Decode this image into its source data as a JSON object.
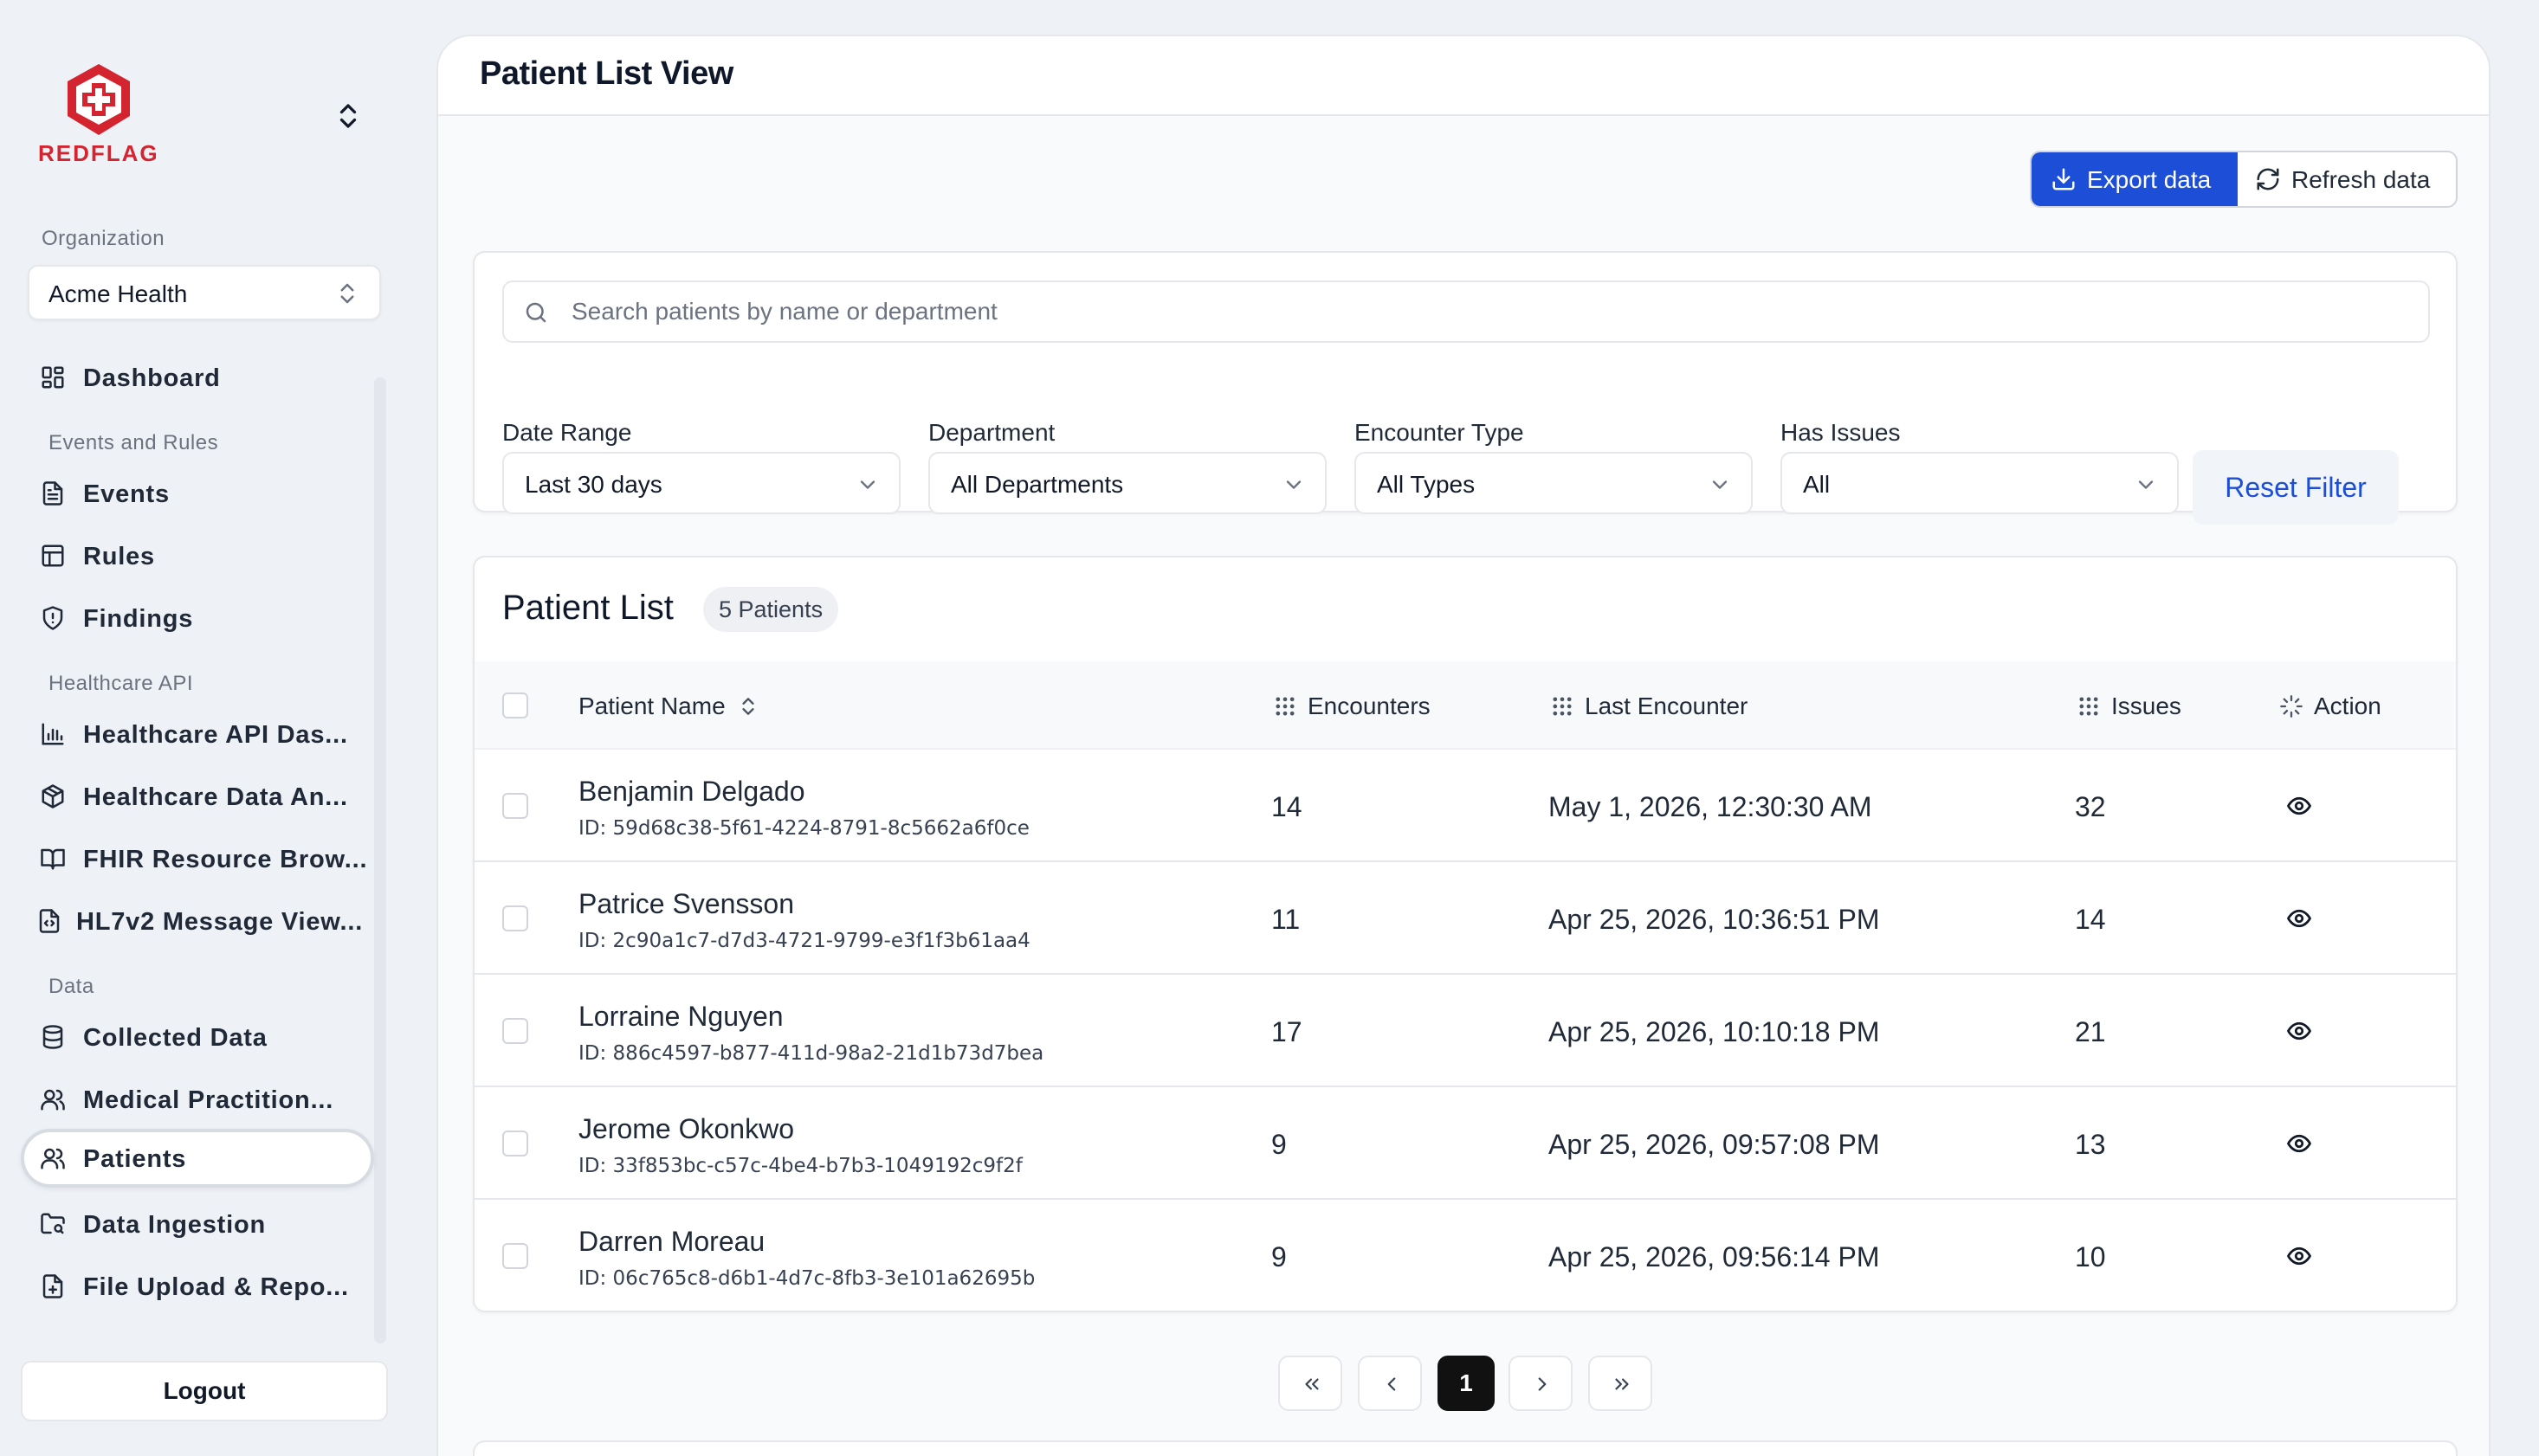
{
  "brand": {
    "name": "REDFLAG",
    "color": "#d3242f"
  },
  "organization": {
    "label": "Organization",
    "value": "Acme Health"
  },
  "nav": {
    "dashboard": {
      "label": "Dashboard",
      "icon": "dashboard-grid-icon"
    },
    "sections": {
      "events_rules": "Events and Rules",
      "healthcare_api": "Healthcare API",
      "data": "Data"
    },
    "items": [
      {
        "label": "Events",
        "icon": "file-text-icon"
      },
      {
        "label": "Rules",
        "icon": "table-icon"
      },
      {
        "label": "Findings",
        "icon": "shield-alert-icon"
      },
      {
        "label": "Healthcare API Das...",
        "icon": "bar-chart-icon"
      },
      {
        "label": "Healthcare Data An...",
        "icon": "package-icon"
      },
      {
        "label": "FHIR Resource Brow...",
        "icon": "book-open-icon"
      },
      {
        "label": "HL7v2 Message View...",
        "icon": "file-code-icon"
      },
      {
        "label": "Collected Data",
        "icon": "database-icon"
      },
      {
        "label": "Medical Practition...",
        "icon": "users-icon"
      },
      {
        "label": "Patients",
        "icon": "users-icon"
      },
      {
        "label": "Data Ingestion",
        "icon": "folder-search-icon"
      },
      {
        "label": "File Upload & Repo...",
        "icon": "file-plus-icon"
      }
    ],
    "active": "Patients",
    "logout": "Logout"
  },
  "page": {
    "title": "Patient List View"
  },
  "toolbar": {
    "export_label": "Export data",
    "refresh_label": "Refresh data",
    "accent": "#1d4ed8"
  },
  "filters": {
    "search_placeholder": "Search patients by name or department",
    "date_range": {
      "label": "Date Range",
      "value": "Last 30 days"
    },
    "department": {
      "label": "Department",
      "value": "All Departments"
    },
    "encounter_type": {
      "label": "Encounter Type",
      "value": "All Types"
    },
    "has_issues": {
      "label": "Has Issues",
      "value": "All"
    },
    "reset_label": "Reset Filter"
  },
  "patient_list": {
    "title": "Patient List",
    "count_badge": "5 Patients",
    "columns": {
      "name": "Patient Name",
      "encounters": "Encounters",
      "last_encounter": "Last Encounter",
      "issues": "Issues",
      "action": "Action"
    },
    "rows": [
      {
        "name": "Benjamin Delgado",
        "id": "ID: 59d68c38-5f61-4224-8791-8c5662a6f0ce",
        "encounters": "14",
        "last_encounter": "May 1, 2026, 12:30:30 AM",
        "issues": "32"
      },
      {
        "name": "Patrice Svensson",
        "id": "ID: 2c90a1c7-d7d3-4721-9799-e3f1f3b61aa4",
        "encounters": "11",
        "last_encounter": "Apr 25, 2026, 10:36:51 PM",
        "issues": "14"
      },
      {
        "name": "Lorraine Nguyen",
        "id": "ID: 886c4597-b877-411d-98a2-21d1b73d7bea",
        "encounters": "17",
        "last_encounter": "Apr 25, 2026, 10:10:18 PM",
        "issues": "21"
      },
      {
        "name": "Jerome Okonkwo",
        "id": "ID: 33f853bc-c57c-4be4-b7b3-1049192c9f2f",
        "encounters": "9",
        "last_encounter": "Apr 25, 2026, 09:57:08 PM",
        "issues": "13"
      },
      {
        "name": "Darren Moreau",
        "id": "ID: 06c765c8-d6b1-4d7c-8fb3-3e101a62695b",
        "encounters": "9",
        "last_encounter": "Apr 25, 2026, 09:56:14 PM",
        "issues": "10"
      }
    ]
  },
  "pagination": {
    "current_page": "1"
  }
}
